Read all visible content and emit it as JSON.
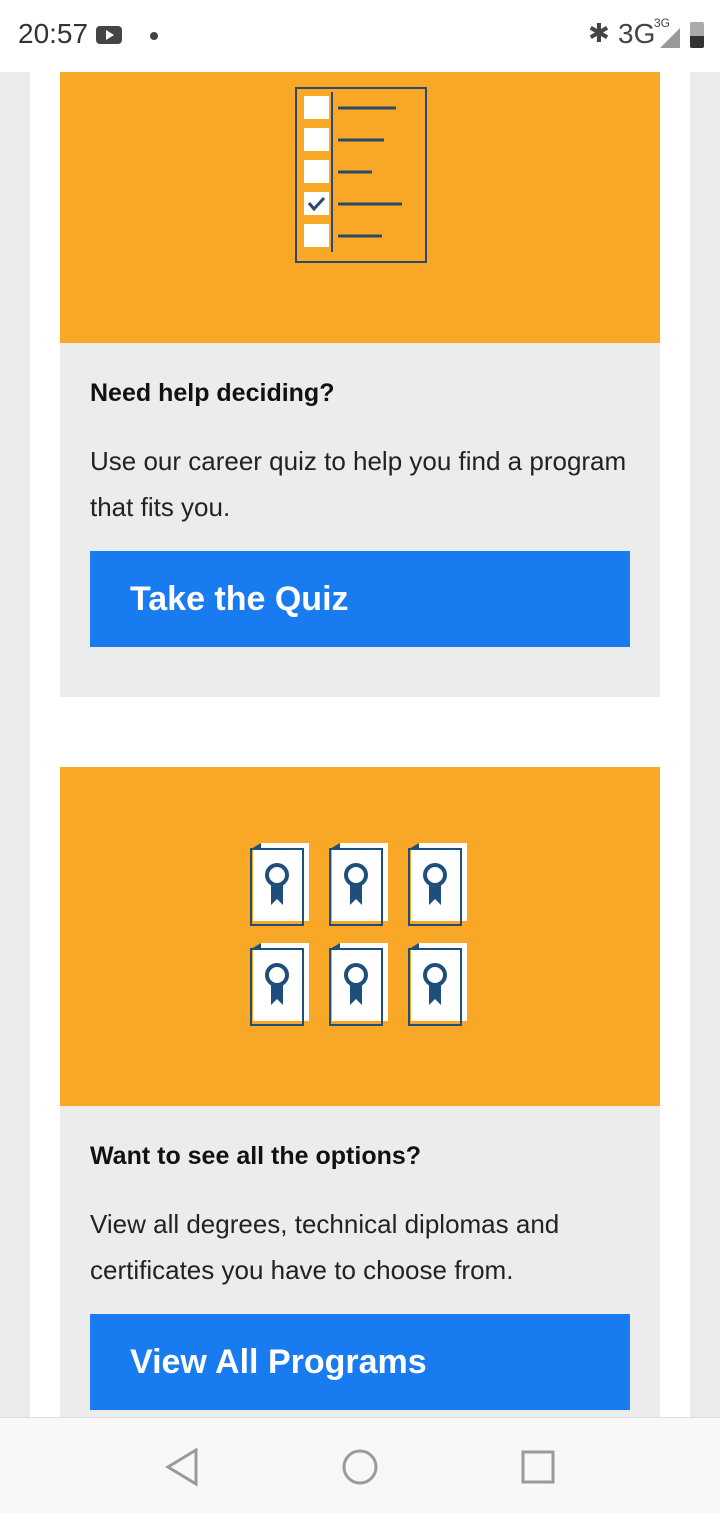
{
  "status_bar": {
    "time": "20:57",
    "network": "3G",
    "network_small": "3G",
    "icons": [
      "youtube-icon",
      "notification-dot-icon",
      "bluetooth-icon",
      "signal-icon",
      "battery-icon"
    ]
  },
  "cards": [
    {
      "illustration": "checklist-icon",
      "title": "Need help deciding?",
      "text": "Use our career quiz to help you find a program that fits you.",
      "button": "Take the Quiz"
    },
    {
      "illustration": "certificates-icon",
      "title": "Want to see all the options?",
      "text": "View all degrees, technical diplomas and certificates you have to choose from.",
      "button": "View All Programs"
    }
  ],
  "nav_bar": {
    "buttons": [
      "back-icon",
      "home-icon",
      "recents-icon"
    ]
  },
  "colors": {
    "banner": "#f8a826",
    "button": "#197bf0",
    "illustration_line": "#2b4a6b",
    "card_background": "#ececec"
  }
}
